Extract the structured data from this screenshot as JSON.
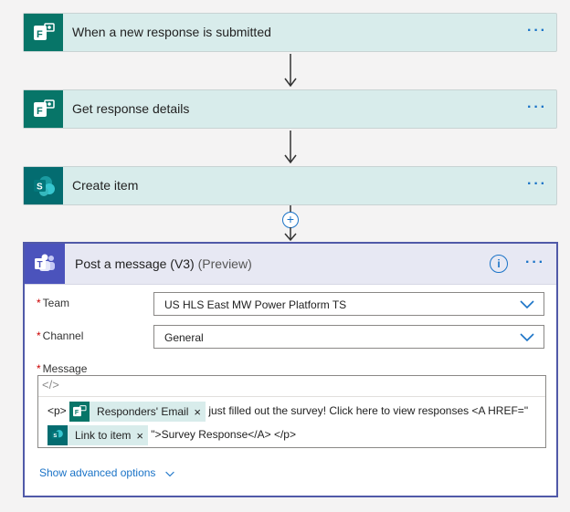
{
  "steps": [
    {
      "title": "When a new response is submitted",
      "icon": "forms-icon",
      "menu": "···"
    },
    {
      "title": "Get response details",
      "icon": "forms-icon",
      "menu": "···"
    },
    {
      "title": "Create item",
      "icon": "sharepoint-icon",
      "menu": "···"
    }
  ],
  "add_button": "+",
  "action": {
    "title": "Post a message (V3)",
    "preview": "(Preview)",
    "info": "i",
    "menu": "···",
    "fields": {
      "team": {
        "label": "Team",
        "value": "US HLS East MW Power Platform TS"
      },
      "channel": {
        "label": "Channel",
        "value": "General"
      },
      "message": {
        "label": "Message"
      }
    },
    "code_icon": "</>",
    "message_parts": {
      "p_open": "<p>",
      "token1": "Responders' Email",
      "text1": "just filled out the survey! Click here to view responses <A HREF=\"",
      "token2": "Link to item",
      "text2": "\">Survey Response</A> </p>",
      "remove": "×"
    },
    "show_advanced": "Show advanced options"
  },
  "required_mark": "*",
  "colors": {
    "forms": "#077568",
    "sharepoint": "#036c70",
    "teams": "#4b53bc",
    "accent": "#1a73c7"
  }
}
